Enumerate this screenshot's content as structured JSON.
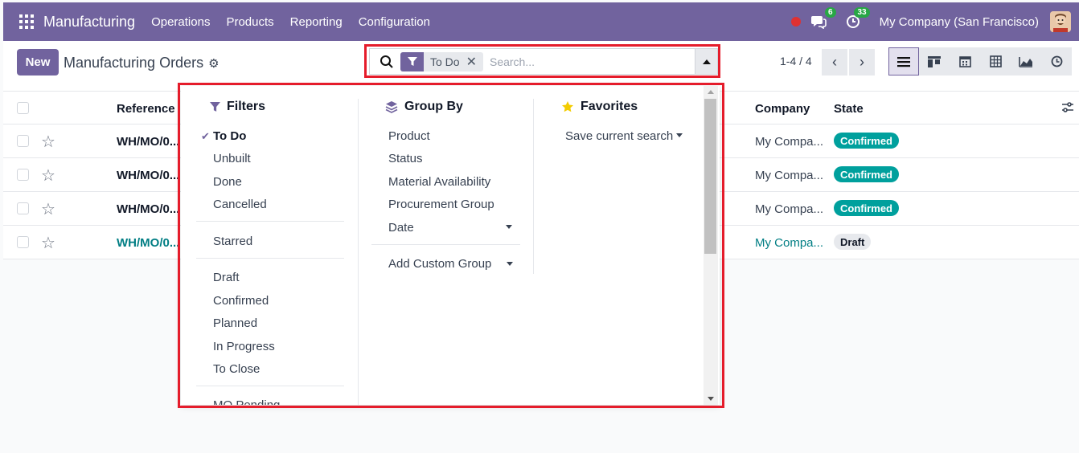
{
  "topbar": {
    "app_name": "Manufacturing",
    "menu": [
      "Operations",
      "Products",
      "Reporting",
      "Configuration"
    ],
    "messages_count": "6",
    "activities_count": "33",
    "company": "My Company (San Francisco)"
  },
  "control": {
    "new_label": "New",
    "title": "Manufacturing Orders",
    "search": {
      "facet_label": "To Do",
      "placeholder": "Search..."
    },
    "pager": "1-4 / 4"
  },
  "table": {
    "headers": {
      "reference": "Reference",
      "company": "Company",
      "state": "State"
    },
    "rows": [
      {
        "reference": "WH/MO/0...",
        "company": "My Compa...",
        "state": "Confirmed"
      },
      {
        "reference": "WH/MO/0...",
        "company": "My Compa...",
        "state": "Confirmed"
      },
      {
        "reference": "WH/MO/0...",
        "company": "My Compa...",
        "state": "Confirmed"
      },
      {
        "reference": "WH/MO/0...",
        "company": "My Compa...",
        "state": "Draft"
      }
    ]
  },
  "dropdown": {
    "filters": {
      "title": "Filters",
      "group1": [
        "To Do",
        "Unbuilt",
        "Done",
        "Cancelled"
      ],
      "group2": [
        "Starred"
      ],
      "group3": [
        "Draft",
        "Confirmed",
        "Planned",
        "In Progress",
        "To Close"
      ],
      "group4": [
        "MO Pending"
      ]
    },
    "group_by": {
      "title": "Group By",
      "items": [
        "Product",
        "Status",
        "Material Availability",
        "Procurement Group",
        "Date"
      ],
      "custom": "Add Custom Group"
    },
    "favorites": {
      "title": "Favorites",
      "save": "Save current search"
    }
  },
  "colors": {
    "brand": "#71639e",
    "confirmed": "#00a09d",
    "link": "#017e84",
    "highlight": "#e51c2b"
  }
}
